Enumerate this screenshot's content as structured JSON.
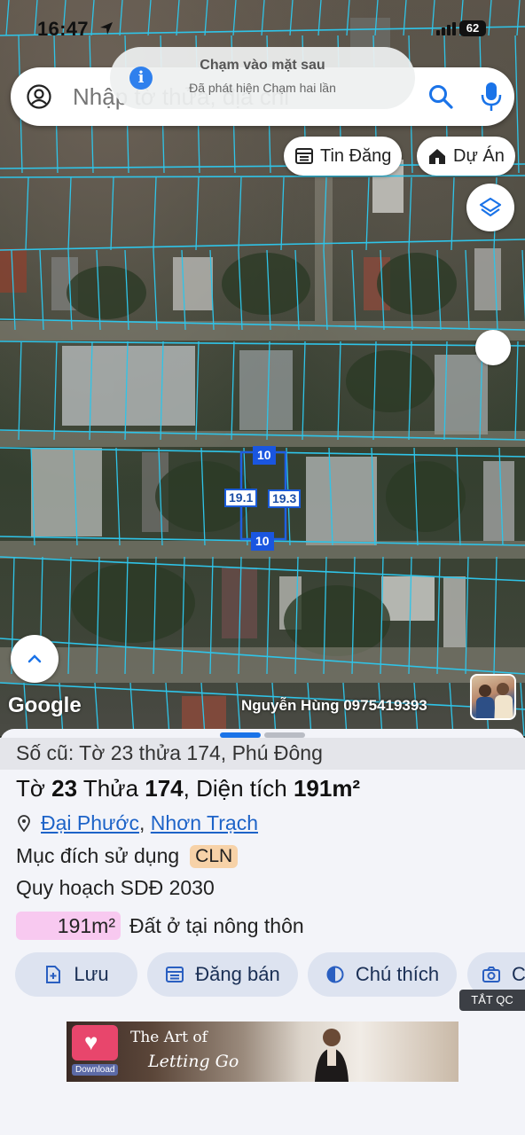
{
  "status_bar": {
    "time": "16:47",
    "battery": "62"
  },
  "toast": {
    "title": "Chạm vào mặt sau",
    "subtitle": "Đã phát hiện Chạm hai lần"
  },
  "search": {
    "placeholder": "Nhập tờ thửa, địa chỉ",
    "value": ""
  },
  "chips": [
    {
      "label": "Tin Đăng",
      "icon": "calendar-list-icon"
    },
    {
      "label": "Dự Án",
      "icon": "house-icon"
    }
  ],
  "parcel_labels": {
    "top": "10",
    "bottom": "10",
    "left": "19.1",
    "right": "19.3"
  },
  "map_footer": {
    "logo": "Google",
    "attribution": "Nguyễn Hùng 0975419393"
  },
  "sheet": {
    "old_ref": "Số cũ: Tờ 23 thửa 174, Phú Đông",
    "title_prefix": "Tờ ",
    "sheet_no": "23",
    "title_mid": " Thửa ",
    "plot_no": "174",
    "title_suffix": ", Diện tích ",
    "area_value": "191m²",
    "ward": "Đại Phước",
    "district": "Nhơn Trạch",
    "usage_label": "Mục đích sử dụng",
    "usage_code": "CLN",
    "plan_label": "Quy hoạch SDĐ 2030",
    "plan_area": "191m²",
    "plan_desc": "Đất ở tại nông thôn",
    "actions": [
      {
        "label": "Lưu",
        "icon": "file-add-icon"
      },
      {
        "label": "Đăng bán",
        "icon": "calendar-list-icon"
      },
      {
        "label": "Chú thích",
        "icon": "contrast-icon"
      },
      {
        "label": "C",
        "icon": "camera-icon"
      }
    ],
    "hide_ad": "TẮT QC"
  },
  "ad": {
    "line1": "The Art of",
    "line2": "Letting Go",
    "download": "Download"
  },
  "colors": {
    "parcel_line": "#2fc4e8",
    "accent": "#1a56e0",
    "cln": "#f7d2a8",
    "plan": "#f8c9f0"
  }
}
